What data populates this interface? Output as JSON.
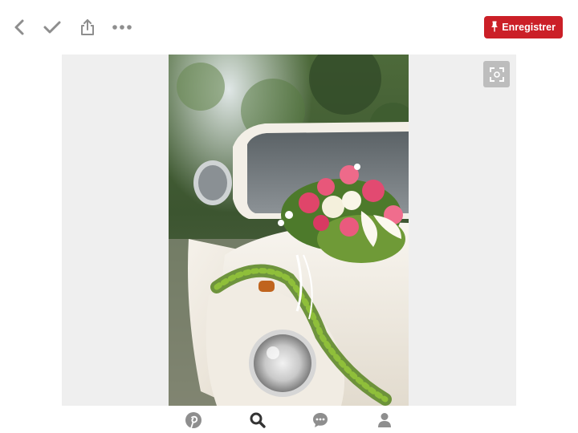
{
  "toolbar": {
    "save_label": "Enregistrer",
    "icons": [
      "back-icon",
      "check-icon",
      "share-icon",
      "more-icon"
    ]
  },
  "pin": {
    "image_alt": "",
    "fullscreen_icon": "expand-icon"
  },
  "bottom_nav": {
    "items": [
      {
        "icon": "pinterest-icon",
        "active": false
      },
      {
        "icon": "search-icon",
        "active": true
      },
      {
        "icon": "chat-icon",
        "active": false
      },
      {
        "icon": "profile-icon",
        "active": false
      }
    ]
  },
  "colors": {
    "brand_red": "#cb1f27",
    "icon_gray": "#8e8e8e",
    "icon_active": "#333333",
    "stage_bg": "#efefef"
  }
}
